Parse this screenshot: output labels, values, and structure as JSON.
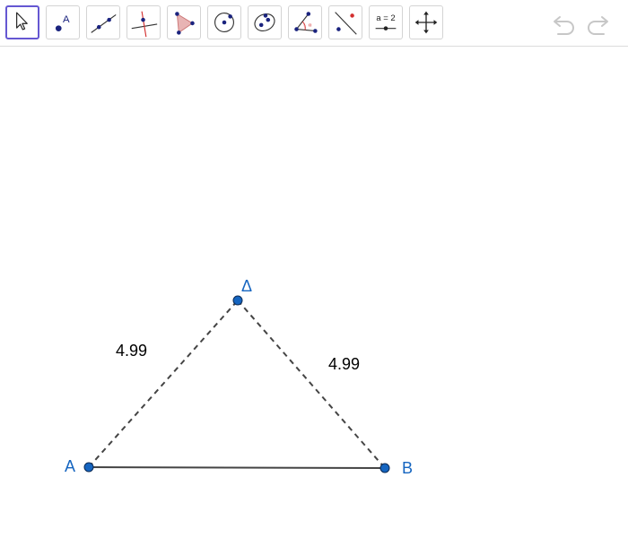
{
  "toolbar": {
    "tools": [
      {
        "icon": "move-arrow-icon",
        "selected": true
      },
      {
        "icon": "point-icon",
        "label": "A"
      },
      {
        "icon": "line-icon"
      },
      {
        "icon": "perpendicular-line-icon"
      },
      {
        "icon": "polygon-icon"
      },
      {
        "icon": "circle-with-center-icon"
      },
      {
        "icon": "conic-icon"
      },
      {
        "icon": "angle-icon"
      },
      {
        "icon": "reflect-icon"
      },
      {
        "icon": "slider-icon",
        "label": "a = 2"
      },
      {
        "icon": "move-view-icon"
      }
    ],
    "undo_icon": "undo-icon",
    "redo_icon": "redo-icon"
  },
  "construction": {
    "points": {
      "A": {
        "label": "A"
      },
      "B": {
        "label": "B"
      },
      "top": {
        "label": "Δ"
      }
    },
    "segments": {
      "left_label": "4.99",
      "right_label": "4.99"
    },
    "colors": {
      "point_fill": "#1565c0",
      "point_label": "#1565c0",
      "segment": "#444444",
      "text": "#000000",
      "selected_tool_border": "#6557d2"
    }
  }
}
